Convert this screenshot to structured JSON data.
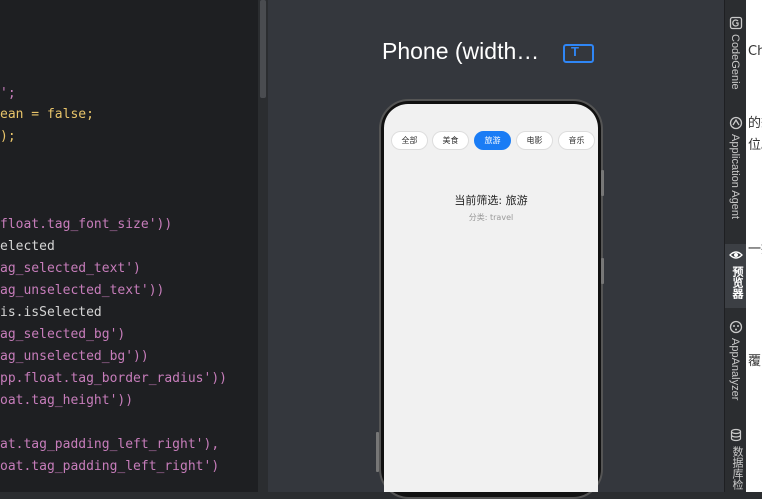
{
  "editor": {
    "lines": [
      {
        "t": "';",
        "k": "c-str"
      },
      {
        "t": "ean = false;",
        "k": "c-kw"
      },
      {
        "t": ");",
        "k": "c-kw"
      },
      {
        "t": "float.tag_font_size'))",
        "k": "c-str"
      },
      {
        "t": "elected",
        "k": "c-id"
      },
      {
        "t": "ag_selected_text')",
        "k": "c-str"
      },
      {
        "t": "ag_unselected_text'))",
        "k": "c-str"
      },
      {
        "t": "is.isSelected",
        "k": "c-id"
      },
      {
        "t": "ag_selected_bg')",
        "k": "c-str"
      },
      {
        "t": "ag_unselected_bg'))",
        "k": "c-str"
      },
      {
        "t": "pp.float.tag_border_radius'))",
        "k": "c-str"
      },
      {
        "t": "oat.tag_height'))",
        "k": "c-str"
      },
      {
        "t": "at.tag_padding_left_right'),",
        "k": "c-str"
      },
      {
        "t": "oat.tag_padding_left_right')",
        "k": "c-str"
      }
    ]
  },
  "preview": {
    "title": "Phone (width…",
    "badge_label": "T",
    "tabs": [
      {
        "label": "全部",
        "selected": false
      },
      {
        "label": "美食",
        "selected": false
      },
      {
        "label": "旅游",
        "selected": true
      },
      {
        "label": "电影",
        "selected": false
      },
      {
        "label": "音乐",
        "selected": false
      }
    ],
    "filter_text": "当前筛选: 旅游",
    "category_text": "分类: travel"
  },
  "tool_window": {
    "items": [
      {
        "label": "CodeGenie",
        "icon": "codegenie-icon"
      },
      {
        "label": "Application Agent",
        "icon": "agent-icon"
      },
      {
        "label": "预览器",
        "icon": "eye-icon",
        "active": true
      },
      {
        "label": "AppAnalyzer",
        "icon": "analyzer-icon"
      },
      {
        "label": "数据库检",
        "icon": "database-icon"
      }
    ]
  },
  "doc_panel": {
    "fragments": [
      "Ch",
      "的想",
      "位。",
      "一提",
      "覆"
    ]
  },
  "colors": {
    "accent": "#1a7cf5",
    "editor_bg": "#1e1f22",
    "preview_bg": "#34373d"
  }
}
